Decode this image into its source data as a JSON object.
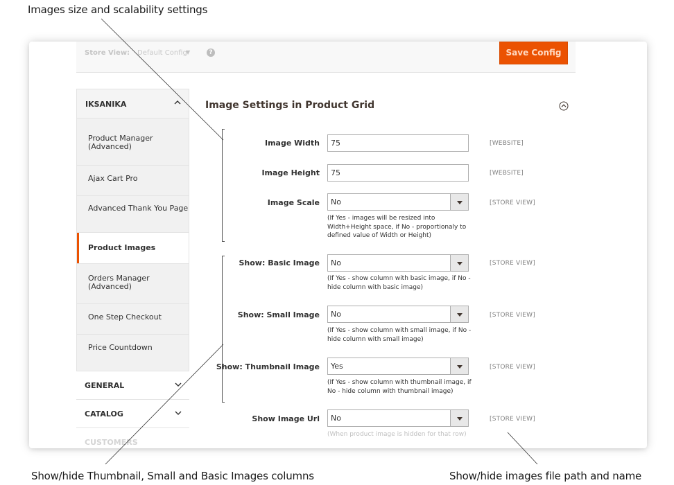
{
  "callouts": {
    "top": "Images size and scalability settings",
    "bottom_left": "Show/hide Thumbnail, Small and Basic Images columns",
    "bottom_right": "Show/hide images file path and name"
  },
  "topbar": {
    "store_view_label": "Store View:",
    "store_view_value": "Default Config",
    "help": "?",
    "save_button": "Save Config"
  },
  "sidebar": {
    "iksanika": "IKSANIKA",
    "items": [
      "Product Manager (Advanced)",
      "Ajax Cart Pro",
      "Advanced Thank You Page",
      "Product Images",
      "Orders Manager (Advanced)",
      "One Step Checkout",
      "Price Countdown"
    ],
    "active_item": "Product Images",
    "general": "GENERAL",
    "catalog": "CATALOG",
    "customers": "CUSTOMERS"
  },
  "section": {
    "title": "Image Settings in Product Grid"
  },
  "fields": {
    "image_width": {
      "label": "Image Width",
      "value": "75",
      "scope": "[WEBSITE]"
    },
    "image_height": {
      "label": "Image Height",
      "value": "75",
      "scope": "[WEBSITE]"
    },
    "image_scale": {
      "label": "Image Scale",
      "value": "No",
      "scope": "[STORE VIEW]",
      "note": "(If Yes - images will be resized into Width+Height space, if No - proportionaly to defined value of Width or Height)"
    },
    "show_basic": {
      "label": "Show: Basic Image",
      "value": "No",
      "scope": "[STORE VIEW]",
      "note": "(If Yes - show column with basic image, if No - hide column with basic image)"
    },
    "show_small": {
      "label": "Show: Small Image",
      "value": "No",
      "scope": "[STORE VIEW]",
      "note": "(If Yes - show column with small image, if No - hide column with small image)"
    },
    "show_thumb": {
      "label": "Show: Thumbnail Image",
      "value": "Yes",
      "scope": "[STORE VIEW]",
      "note": "(If Yes - show column with thumbnail image, if No - hide column with thumbnail image)"
    },
    "show_url": {
      "label": "Show Image Url",
      "value": "No",
      "scope": "[STORE VIEW]",
      "note": "(When product image is hidden for that row)"
    }
  },
  "colors": {
    "accent": "#eb5202",
    "text": "#303030",
    "sidebar_bg": "#f1f1f1"
  },
  "icons": {
    "expand": "chevron-up-icon",
    "collapse": "chevron-down-icon",
    "section_toggle": "circle-chevron-up-icon",
    "select_arrow": "caret-down-icon"
  }
}
